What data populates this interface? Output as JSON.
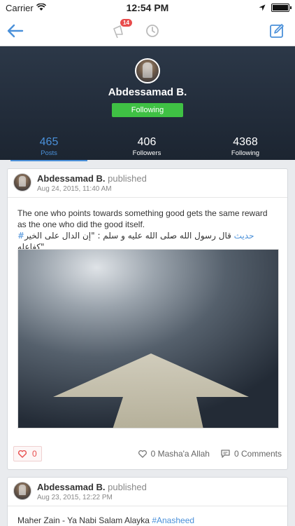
{
  "status_bar": {
    "carrier": "Carrier",
    "time": "12:54 PM"
  },
  "nav": {
    "badge_count": "14"
  },
  "profile": {
    "name": "Abdessamad B.",
    "follow_button": "Following",
    "stats": [
      {
        "value": "465",
        "label": "Posts"
      },
      {
        "value": "406",
        "label": "Followers"
      },
      {
        "value": "4368",
        "label": "Following"
      }
    ]
  },
  "posts": [
    {
      "author": "Abdessamad B.",
      "action": "published",
      "timestamp": "Aug 24, 2015, 11:40 AM",
      "text": "The one who points towards something good gets the same reward as the one who did the good itself.",
      "arabic_text": "قال رسول الله صلى الله عليه و سلم : \"إن الدال على الخير كفاعله\"",
      "hashtag": "#حديث",
      "likes": "0",
      "mashallah": "0 Masha'a Allah",
      "comments": "0 Comments"
    },
    {
      "author": "Abdessamad B.",
      "action": "published",
      "timestamp": "Aug 23, 2015, 12:22 PM",
      "text": "Maher Zain - Ya Nabi Salam Alayka",
      "hashtag": "#Anasheed"
    }
  ],
  "colors": {
    "accent": "#4a90d9",
    "follow_green": "#3fc144",
    "like_red": "#e84d4d",
    "header_bg": "#2c3848"
  }
}
